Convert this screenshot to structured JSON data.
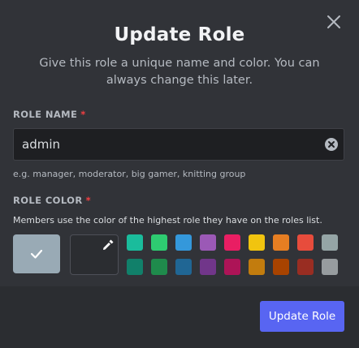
{
  "dialog": {
    "title": "Update Role",
    "subtitle": "Give this role a unique name and color. You can always change this later.",
    "close_icon": "close-icon"
  },
  "role_name": {
    "label": "ROLE NAME",
    "required_marker": "*",
    "value": "admin",
    "hint": "e.g. manager, moderator, big gamer, knitting group",
    "clear_icon": "clear-circle-icon"
  },
  "role_color": {
    "label": "ROLE COLOR",
    "required_marker": "*",
    "description": "Members use the color of the highest role they have on the roles list.",
    "default_color": "#99aab5",
    "selected": "default",
    "custom_icon": "eyedropper-icon",
    "palette_top": [
      "#1abc9c",
      "#2ecc71",
      "#3498db",
      "#9b59b6",
      "#e91e63",
      "#f1c40f",
      "#e67e22",
      "#e74c3c",
      "#95a5a6"
    ],
    "palette_bottom": [
      "#11806a",
      "#1f8b4c",
      "#206694",
      "#71368a",
      "#ad1457",
      "#c27c0e",
      "#a84300",
      "#992d22",
      "#979c9f"
    ]
  },
  "footer": {
    "submit_label": "Update Role"
  },
  "colors": {
    "modal_bg": "#313338",
    "footer_bg": "#2b2d31",
    "primary": "#5865f2"
  }
}
